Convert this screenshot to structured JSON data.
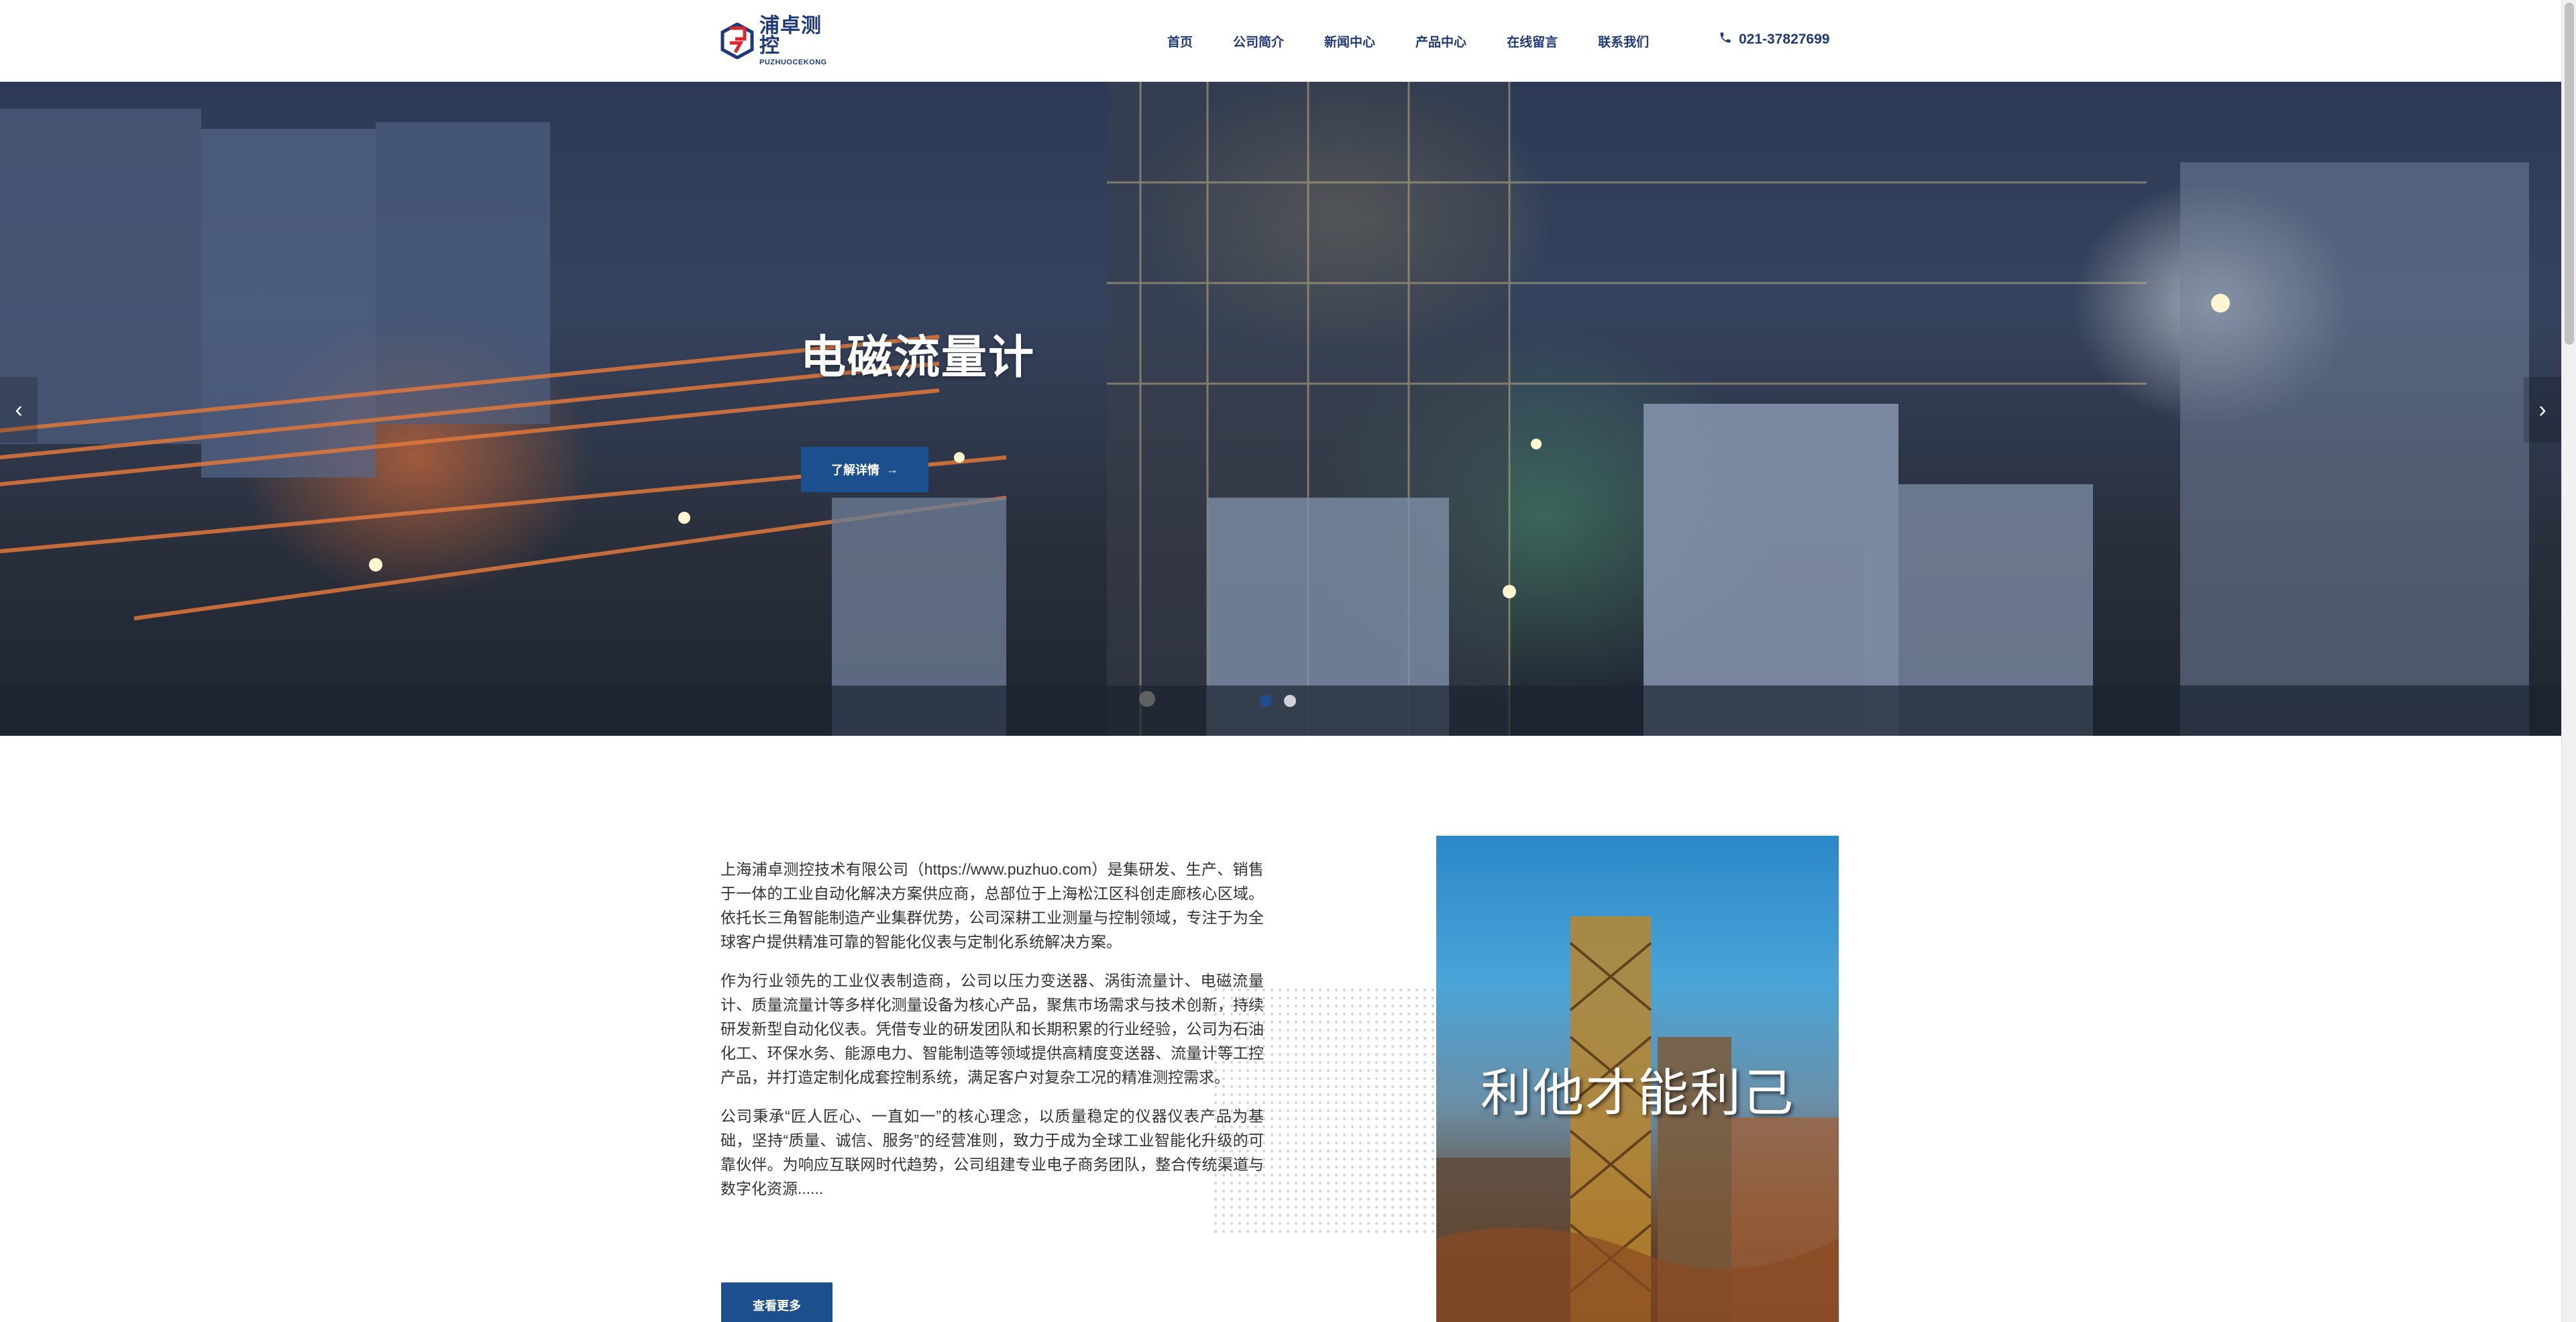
{
  "header": {
    "logo_cn": "浦卓测控",
    "logo_en": "PUZHUOCEKONG",
    "nav": [
      "首页",
      "公司简介",
      "新闻中心",
      "产品中心",
      "在线留言",
      "联系我们"
    ],
    "phone": "021-37827699"
  },
  "hero": {
    "title": "电磁流量计",
    "button": "了解详情",
    "button_arrow": "→",
    "prev": "‹",
    "next": "›",
    "slides_total": 2,
    "active_slide": 1
  },
  "about": {
    "paragraphs": [
      "上海浦卓测控技术有限公司（https://www.puzhuo.com）是集研发、生产、销售于一体的工业自动化解决方案供应商，总部位于上海松江区科创走廊核心区域。依托长三角智能制造产业集群优势，公司深耕工业测量与控制领域，专注于为全球客户提供精准可靠的智能化仪表与定制化系统解决方案。",
      "作为行业领先的工业仪表制造商，公司以压力变送器、涡街流量计、电磁流量计、质量流量计等多样化测量设备为核心产品，聚焦市场需求与技术创新，持续研发新型自动化仪表。凭借专业的研发团队和长期积累的行业经验，公司为石油化工、环保水务、能源电力、智能制造等领域提供高精度变送器、流量计等工控产品，并打造定制化成套控制系统，满足客户对复杂工况的精准测控需求。",
      "公司秉承“匠人匠心、一直如一”的核心理念，以质量稳定的仪器仪表产品为基础，坚持“质量、诚信、服务”的经营准则，致力于成为全球工业智能化升级的可靠伙伴。为响应互联网时代趋势，公司组建专业电子商务团队，整合传统渠道与数字化资源......"
    ],
    "more_button": "查看更多",
    "image_slogan": "利他才能利己"
  },
  "colors": {
    "brand": "#1c4f8e",
    "nav_text": "#1f3a7a",
    "logo_red": "#d8262c"
  }
}
